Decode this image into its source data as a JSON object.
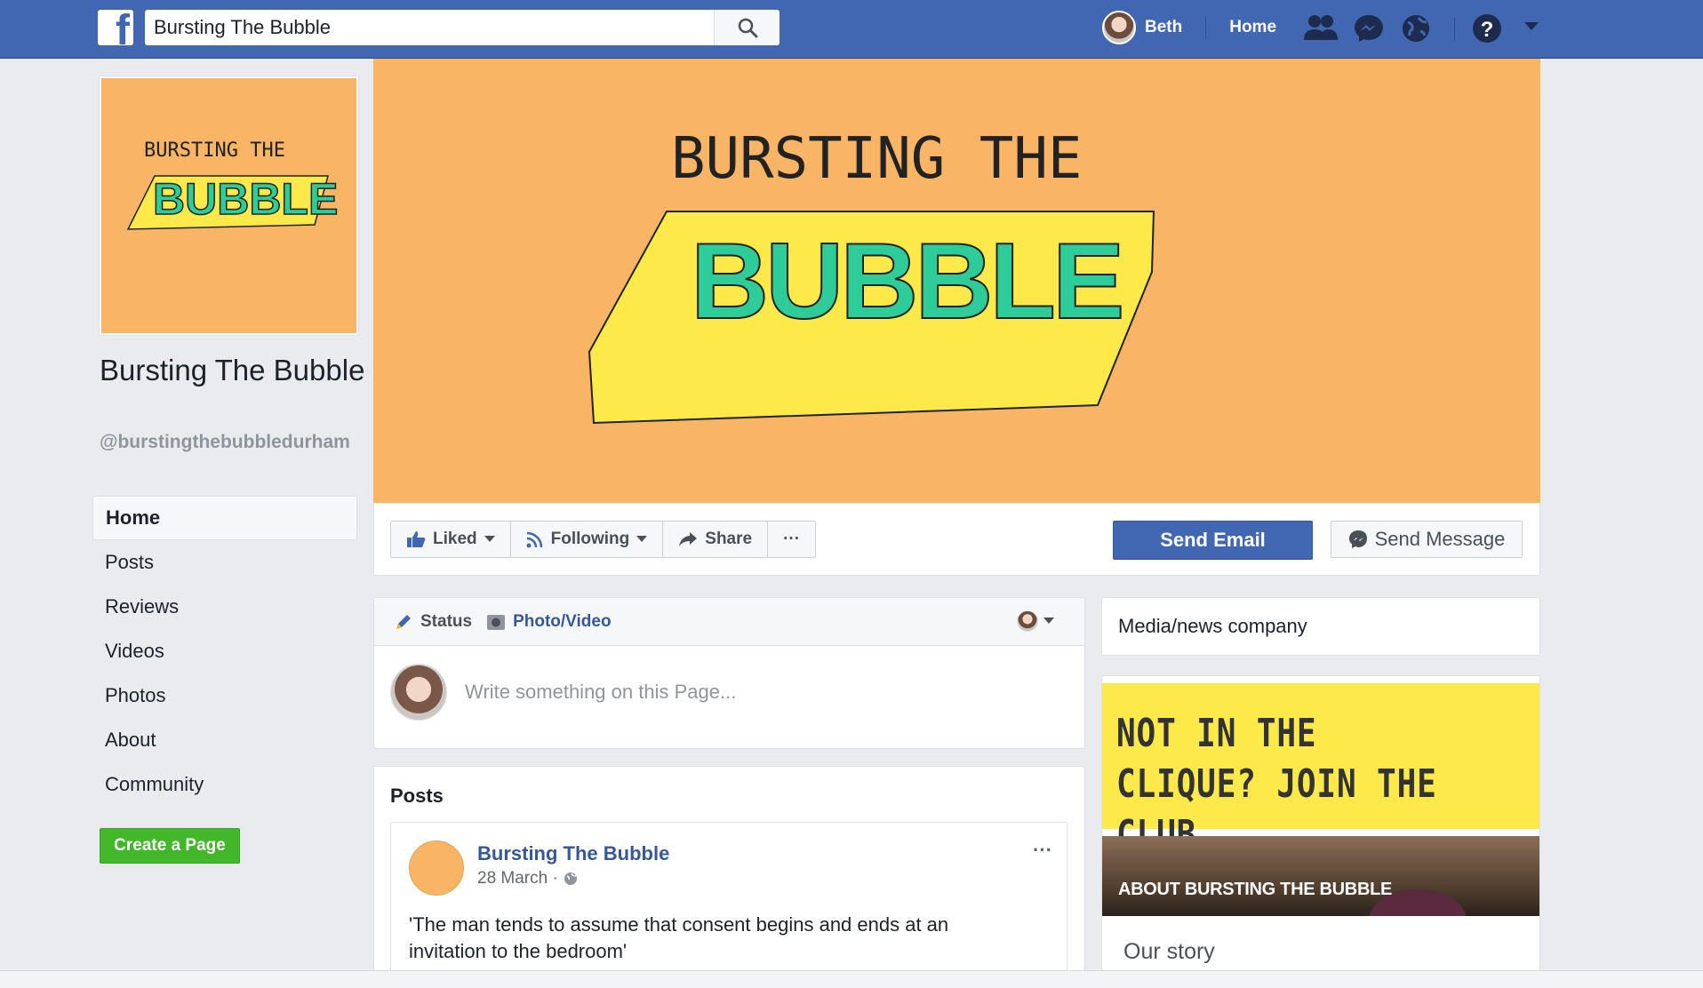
{
  "topbar": {
    "logo": "f",
    "search_value": "Bursting The Bubble",
    "user_name": "Beth",
    "home_label": "Home",
    "icons": [
      "friends-icon",
      "messenger-icon",
      "globe-icon",
      "help-icon",
      "dropdown-icon"
    ],
    "brand_color": "#4267b2"
  },
  "page": {
    "name": "Bursting The Bubble",
    "handle": "@burstingthebubbledurham",
    "logo_text_top": "BURSTING THE",
    "logo_text_bubble": "BUBBLE"
  },
  "left_nav": {
    "items": [
      {
        "label": "Home",
        "active": true
      },
      {
        "label": "Posts"
      },
      {
        "label": "Reviews"
      },
      {
        "label": "Videos"
      },
      {
        "label": "Photos"
      },
      {
        "label": "About"
      },
      {
        "label": "Community"
      }
    ],
    "create_page": "Create a Page"
  },
  "cover": {
    "text_top": "BURSTING THE",
    "text_bubble": "BUBBLE",
    "background": "#f9b566"
  },
  "actions": {
    "liked": "Liked",
    "following": "Following",
    "share": "Share",
    "more": "···",
    "send_email": "Send Email",
    "send_message": "Send Message"
  },
  "composer": {
    "status_tab": "Status",
    "photo_tab": "Photo/Video",
    "placeholder": "Write something on this Page..."
  },
  "posts": {
    "title": "Posts",
    "first": {
      "author": "Bursting The Bubble",
      "date": "28 March ·",
      "more": "···",
      "text": "'The man tends to assume that consent begins and ends at an invitation to the bedroom'"
    }
  },
  "right": {
    "category": "Media/news company",
    "tagline": "NOT IN THE CLIQUE? JOIN THE CLUB.",
    "about_title": "ABOUT BURSTING THE BUBBLE",
    "our_story": "Our story"
  }
}
